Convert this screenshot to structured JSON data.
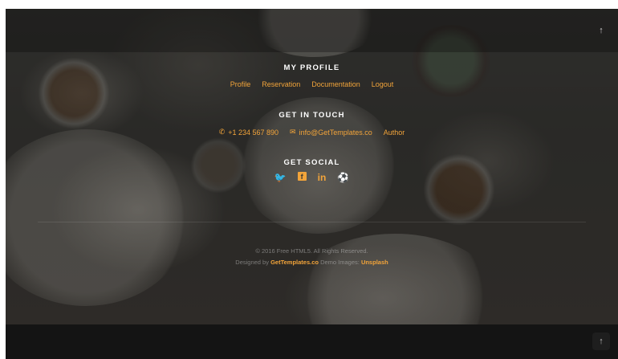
{
  "profile": {
    "heading": "MY PROFILE",
    "links": [
      "Profile",
      "Reservation",
      "Documentation",
      "Logout"
    ]
  },
  "contact": {
    "heading": "GET IN TOUCH",
    "phone": "+1 234 567 890",
    "email": "info@GetTemplates.co",
    "author": "Author"
  },
  "social": {
    "heading": "GET SOCIAL",
    "icons": [
      "twitter-icon",
      "facebook-icon",
      "linkedin-icon",
      "dribbble-icon"
    ],
    "glyphs": [
      "🐦",
      "f",
      "in",
      "⚽"
    ]
  },
  "copyright": {
    "text": "© 2016 Free HTML5. All Rights Reserved.",
    "designed_prefix": "Designed by",
    "designed_link": "GetTemplates.co",
    "demo_prefix": "Demo Images:",
    "demo_link": "Unsplash"
  },
  "gotop": {
    "glyph": "↑"
  },
  "colors": {
    "accent": "#f2a43a",
    "bar": "#141414"
  }
}
